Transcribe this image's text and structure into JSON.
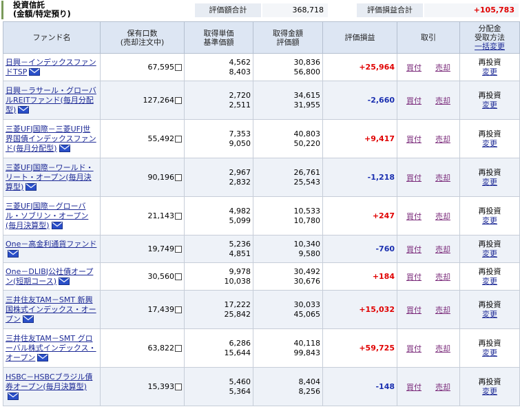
{
  "header": {
    "title_line1": "投資信託",
    "title_line2": "(金額/特定預り)",
    "eval_total_label": "評価額合計",
    "eval_total_value": "368,718",
    "pl_total_label": "評価損益合計",
    "pl_total_value": "+105,783"
  },
  "columns": {
    "fund": "ファンド名",
    "units1": "保有口数",
    "units2": "(売却注文中)",
    "unit1": "取得単価",
    "unit2": "基準価額",
    "amount1": "取得金額",
    "amount2": "評価額",
    "pl": "評価損益",
    "trade": "取引",
    "dist1": "分配金",
    "dist2": "受取方法",
    "dist_link": "一括変更"
  },
  "buy_label": "買付",
  "sell_label": "売却",
  "reinvest_label": "再投資",
  "change_label": "変更",
  "colors": {
    "positive": "#e00000",
    "negative": "#1a2fb0",
    "header_bg": "#dde6f3"
  },
  "rows": [
    {
      "name": "日興－インデックスファンドTSP",
      "units": "67,595",
      "cost": "4,562",
      "nav": "8,403",
      "cost_amt": "30,836",
      "eval_amt": "56,800",
      "pl": "+25,964",
      "sign": "pos"
    },
    {
      "name": "日興－ラサール・グローバルREITファンド(毎月分配型)",
      "units": "127,264",
      "cost": "2,720",
      "nav": "2,511",
      "cost_amt": "34,615",
      "eval_amt": "31,955",
      "pl": "-2,660",
      "sign": "neg"
    },
    {
      "name": "三菱UFJ国際－三菱UFJ世界国債インデックスファンド(毎月分配型)",
      "units": "55,492",
      "cost": "7,353",
      "nav": "9,050",
      "cost_amt": "40,803",
      "eval_amt": "50,220",
      "pl": "+9,417",
      "sign": "pos"
    },
    {
      "name": "三菱UFJ国際－ワールド・リート・オープン(毎月決算型)",
      "units": "90,196",
      "cost": "2,967",
      "nav": "2,832",
      "cost_amt": "26,761",
      "eval_amt": "25,543",
      "pl": "-1,218",
      "sign": "neg"
    },
    {
      "name": "三菱UFJ国際－グローバル・ソブリン・オープン(毎月決算型)",
      "units": "21,143",
      "cost": "4,982",
      "nav": "5,099",
      "cost_amt": "10,533",
      "eval_amt": "10,780",
      "pl": "+247",
      "sign": "pos"
    },
    {
      "name": "One－高金利通貨ファンド",
      "units": "19,749",
      "cost": "5,236",
      "nav": "4,851",
      "cost_amt": "10,340",
      "eval_amt": "9,580",
      "pl": "-760",
      "sign": "neg"
    },
    {
      "name": "One－DLIBJ公社債オープン(短期コース)",
      "units": "30,560",
      "cost": "9,978",
      "nav": "10,038",
      "cost_amt": "30,492",
      "eval_amt": "30,676",
      "pl": "+184",
      "sign": "pos"
    },
    {
      "name": "三井住友TAM－SMT 新興国株式インデックス・オープン",
      "units": "17,439",
      "cost": "17,222",
      "nav": "25,842",
      "cost_amt": "30,033",
      "eval_amt": "45,065",
      "pl": "+15,032",
      "sign": "pos"
    },
    {
      "name": "三井住友TAM－SMT グローバル株式インデックス・オープン",
      "units": "63,822",
      "cost": "6,286",
      "nav": "15,644",
      "cost_amt": "40,118",
      "eval_amt": "99,843",
      "pl": "+59,725",
      "sign": "pos"
    },
    {
      "name": "HSBC－HSBCブラジル債券オープン(毎月決算型)",
      "units": "15,393",
      "cost": "5,460",
      "nav": "5,364",
      "cost_amt": "8,404",
      "eval_amt": "8,256",
      "pl": "-148",
      "sign": "neg"
    }
  ]
}
